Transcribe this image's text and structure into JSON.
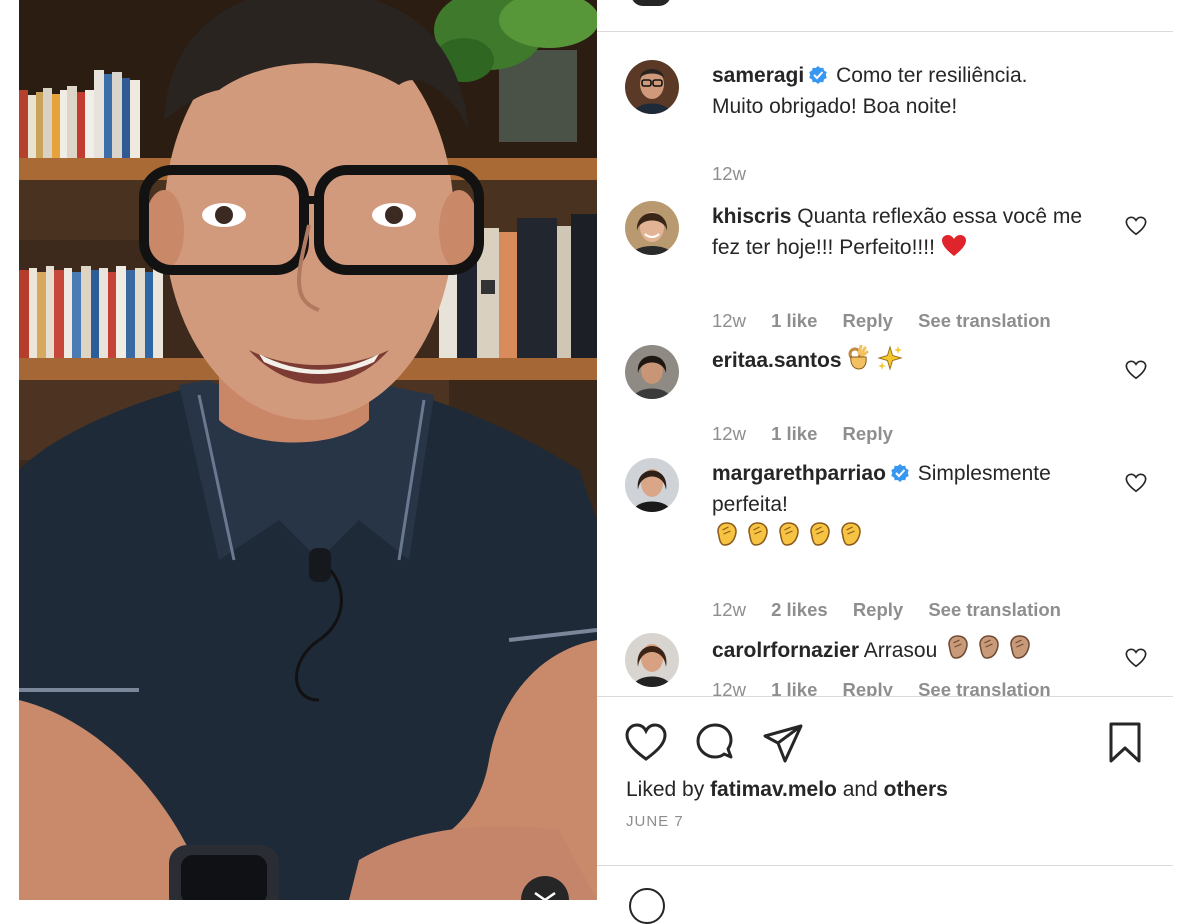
{
  "post": {
    "caption": {
      "username": "sameragi",
      "verified": true,
      "text_line1": "Como ter resiliência.",
      "text_line2": "Muito obrigado! Boa noite!",
      "time": "12w"
    },
    "comments": [
      {
        "username": "khiscris",
        "text": "Quanta reflexão essa você me fez ter hoje!!! Perfeito!!!!",
        "emoji": "red-heart",
        "time": "12w",
        "likes": "1 like",
        "reply": "Reply",
        "translate": "See translation"
      },
      {
        "username": "eritaa.santos",
        "emoji": "ok-hand sparkles",
        "time": "12w",
        "likes": "1 like",
        "reply": "Reply"
      },
      {
        "username": "margarethparriao",
        "verified": true,
        "text": "Simplesmente perfeita!",
        "emoji": "clapping-hands x5",
        "time": "12w",
        "likes": "2 likes",
        "reply": "Reply",
        "translate": "See translation"
      },
      {
        "username": "carolrfornazier",
        "text": "Arrasou",
        "emoji": "clapping-hands x3",
        "time": "12w",
        "likes": "1 like",
        "reply": "Reply",
        "translate": "See translation"
      }
    ],
    "liked_by": {
      "prefix": "Liked by",
      "user": "fatimav.melo",
      "and": "and",
      "others": "others"
    },
    "date": "JUNE 7",
    "icons": [
      "heart-icon",
      "comment-icon",
      "share-icon",
      "bookmark-icon"
    ]
  },
  "colors": {
    "text": "#262626",
    "secondary": "#8e8e8e",
    "verified_blue": "#3897f0",
    "divider": "#dbdbdb",
    "heart_red": "#e0242c"
  }
}
